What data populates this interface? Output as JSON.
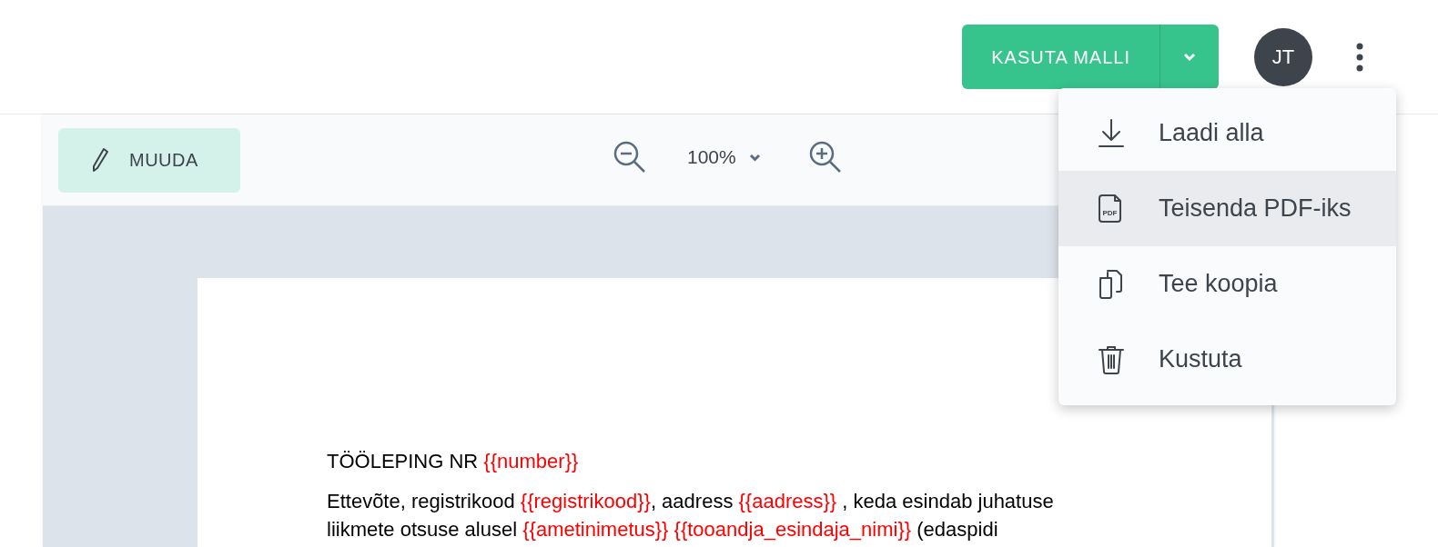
{
  "header": {
    "primary_button": "KASUTA MALLI",
    "avatar": "JT"
  },
  "toolbar": {
    "edit_button": "MUUDA",
    "zoom": "100%"
  },
  "menu": {
    "items": [
      {
        "kind": "download",
        "label": "Laadi alla",
        "selected": false
      },
      {
        "kind": "pdf",
        "label": "Teisenda PDF-iks",
        "icon_text": "PDF",
        "selected": true
      },
      {
        "kind": "copy",
        "label": "Tee koopia",
        "selected": false
      },
      {
        "kind": "delete",
        "label": "Kustuta",
        "selected": false
      }
    ]
  },
  "document": {
    "paragraphs": [
      [
        {
          "text": "TÖÖLEPING NR ",
          "placeholder": false
        },
        {
          "text": "{{number}}",
          "placeholder": true
        }
      ],
      [
        {
          "text": "Ettevõte, registrikood ",
          "placeholder": false
        },
        {
          "text": "{{registrikood}}",
          "placeholder": true
        },
        {
          "text": ", aadress ",
          "placeholder": false
        },
        {
          "text": "{{aadress}}",
          "placeholder": true
        },
        {
          "text": " , keda esindab juhatuse liikmete otsuse alusel ",
          "placeholder": false
        },
        {
          "text": "{{ametinimetus}} {{tooandja_esindaja_nimi}}",
          "placeholder": true
        },
        {
          "text": " (edaspidi",
          "placeholder": false
        }
      ]
    ]
  }
}
